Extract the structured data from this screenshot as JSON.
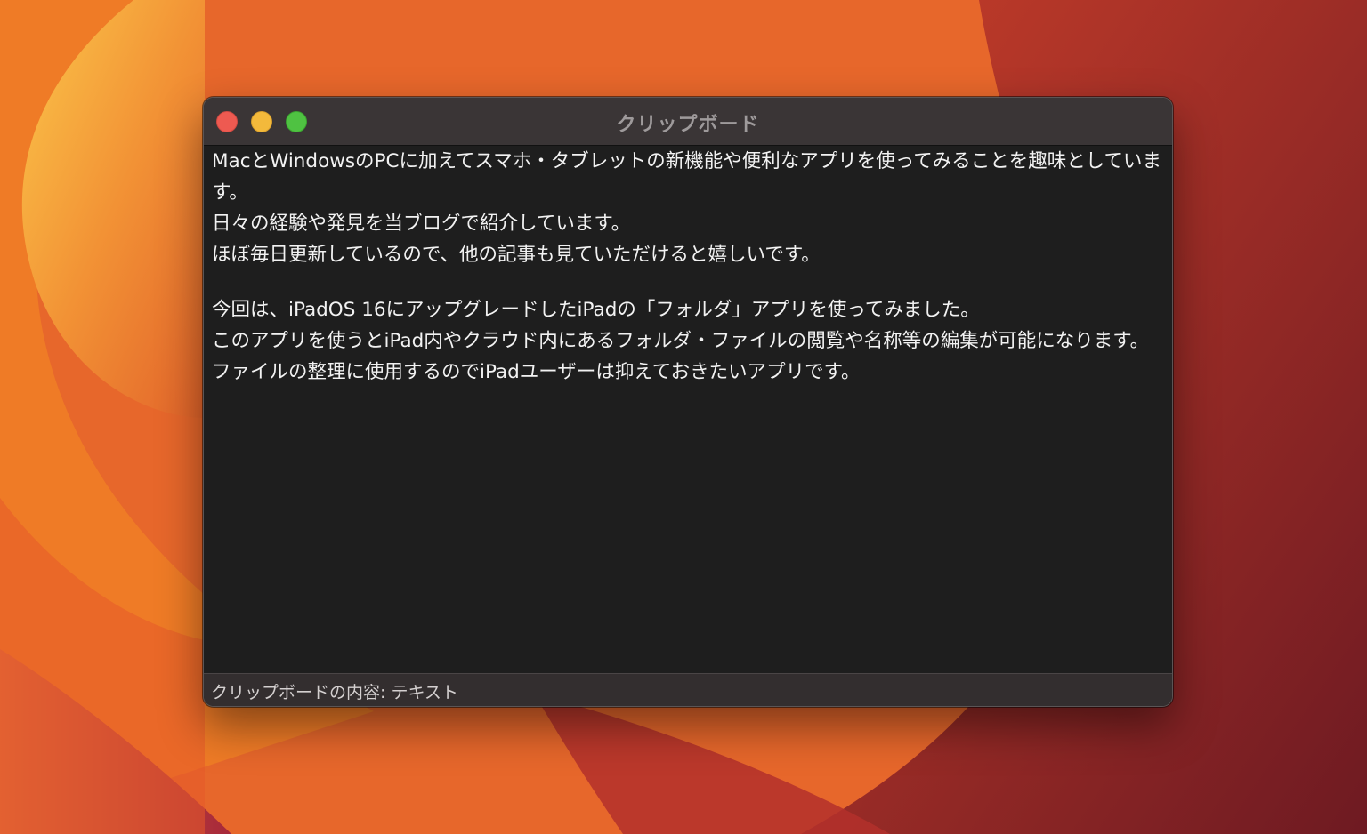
{
  "window": {
    "title": "クリップボード"
  },
  "content": {
    "paragraphs": [
      "MacとWindowsのPCに加えてスマホ・タブレットの新機能や便利なアプリを使ってみることを趣味としています。",
      "日々の経験や発見を当ブログで紹介しています。",
      "ほぼ毎日更新しているので、他の記事も見ていただけると嬉しいです。",
      "今回は、iPadOS 16にアップグレードしたiPadの「フォルダ」アプリを使ってみました。",
      "このアプリを使うとiPad内やクラウド内にあるフォルダ・ファイルの閲覧や名称等の編集が可能になります。",
      "ファイルの整理に使用するのでiPadユーザーは抑えておきたいアプリです。"
    ]
  },
  "statusbar": {
    "text": "クリップボードの内容: テキスト"
  },
  "colors": {
    "close_button": "#ee5a51",
    "minimize_button": "#f3b93b",
    "maximize_button": "#4fc242",
    "window_background": "#1e1e1e",
    "titlebar_background": "#3a3536"
  }
}
